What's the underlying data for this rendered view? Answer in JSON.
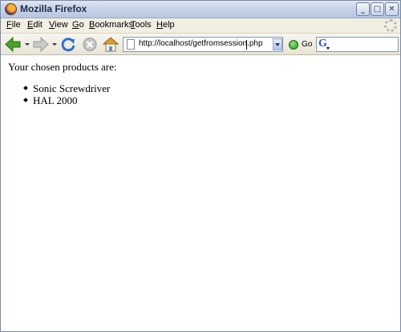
{
  "window": {
    "title": "Mozilla Firefox",
    "controls": {
      "minimize": "_",
      "maximize": "□",
      "close": "✕"
    }
  },
  "menu": [
    "File",
    "Edit",
    "View",
    "Go",
    "Bookmarks",
    "Tools",
    "Help"
  ],
  "toolbar": {
    "icons": [
      "back-icon",
      "forward-icon",
      "reload-icon",
      "stop-icon",
      "home-icon"
    ],
    "url": "http://localhost/getfromsession.php",
    "go_label": "Go",
    "search_engine_letter": "G"
  },
  "page": {
    "intro": "Your chosen products are:",
    "products": [
      "Sonic Screwdriver",
      "HAL 2000"
    ]
  },
  "colors": {
    "back_arrow": "#4aa12e",
    "forward_arrow": "#b9b9b9",
    "reload": "#2f6fd0",
    "stop": "#b5b5b5",
    "home_roof": "#d9a12a"
  }
}
